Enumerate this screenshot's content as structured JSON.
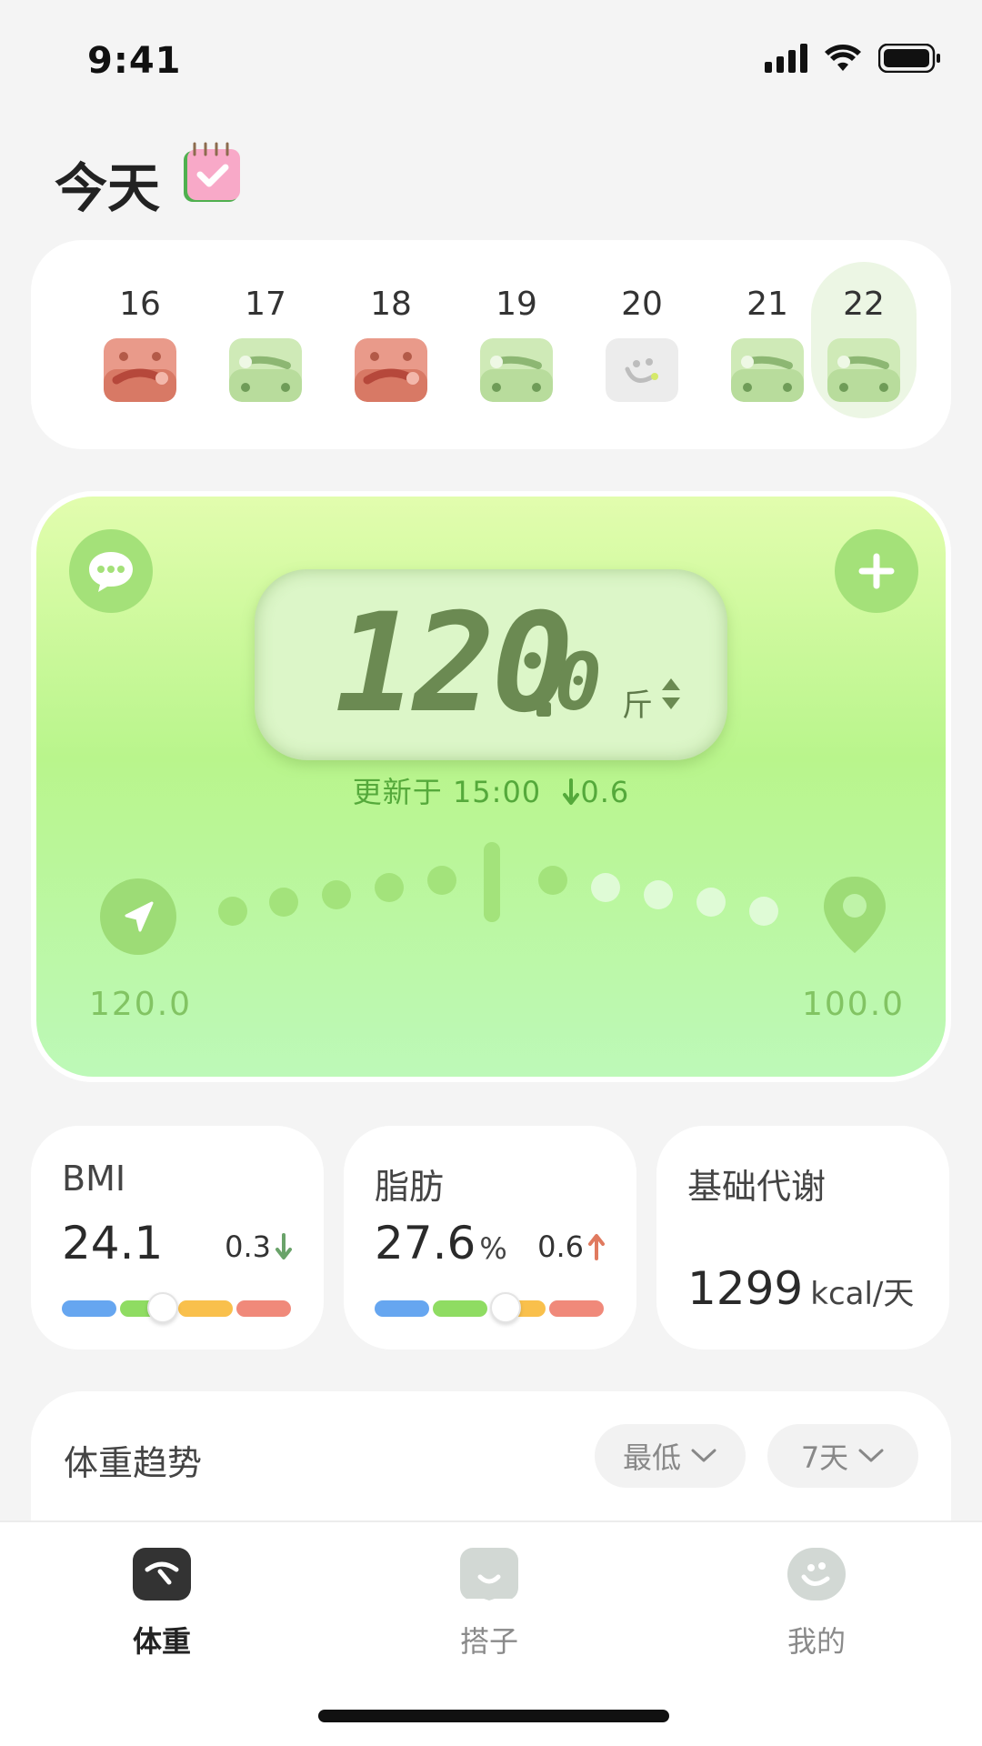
{
  "status_bar": {
    "time": "9:41"
  },
  "header": {
    "title": "今天"
  },
  "week": {
    "days": [
      {
        "num": "16",
        "mood": "red-face"
      },
      {
        "num": "17",
        "mood": "green-face"
      },
      {
        "num": "18",
        "mood": "red-face"
      },
      {
        "num": "19",
        "mood": "green-face"
      },
      {
        "num": "20",
        "mood": "empty-face"
      },
      {
        "num": "21",
        "mood": "green-face"
      },
      {
        "num": "22",
        "mood": "green-face",
        "selected": true
      }
    ]
  },
  "weight": {
    "integer": "120",
    "decimal": "0",
    "unit": "斤",
    "updated": "更新于 15:00",
    "change": "0.6",
    "start": "120.0",
    "goal": "100.0",
    "progress_fraction": 0.5
  },
  "metrics": {
    "bmi": {
      "label": "BMI",
      "value": "24.1",
      "change": "0.3",
      "direction": "down",
      "position_fraction": 0.44
    },
    "fat": {
      "label": "脂肪",
      "value": "27.6",
      "unit": "%",
      "change": "0.6",
      "direction": "up",
      "position_fraction": 0.57
    },
    "bmr": {
      "label": "基础代谢",
      "value": "1299",
      "unit": "kcal/天"
    }
  },
  "trend": {
    "title": "体重趋势",
    "filter": "最低",
    "range": "7天"
  },
  "tabs": [
    {
      "label": "体重",
      "icon": "scale-icon",
      "active": true
    },
    {
      "label": "搭子",
      "icon": "buddy-icon"
    },
    {
      "label": "我的",
      "icon": "profile-icon"
    }
  ],
  "colors": {
    "accent_green": "#a3e37b",
    "lcd_text": "#6b8a52",
    "down_arrow": "#6aa36a",
    "up_arrow": "#e07a5f",
    "scale_blue": "#66a6f0",
    "scale_green": "#8fdc62",
    "scale_yellow": "#f9c04c",
    "scale_red": "#f0897a"
  }
}
